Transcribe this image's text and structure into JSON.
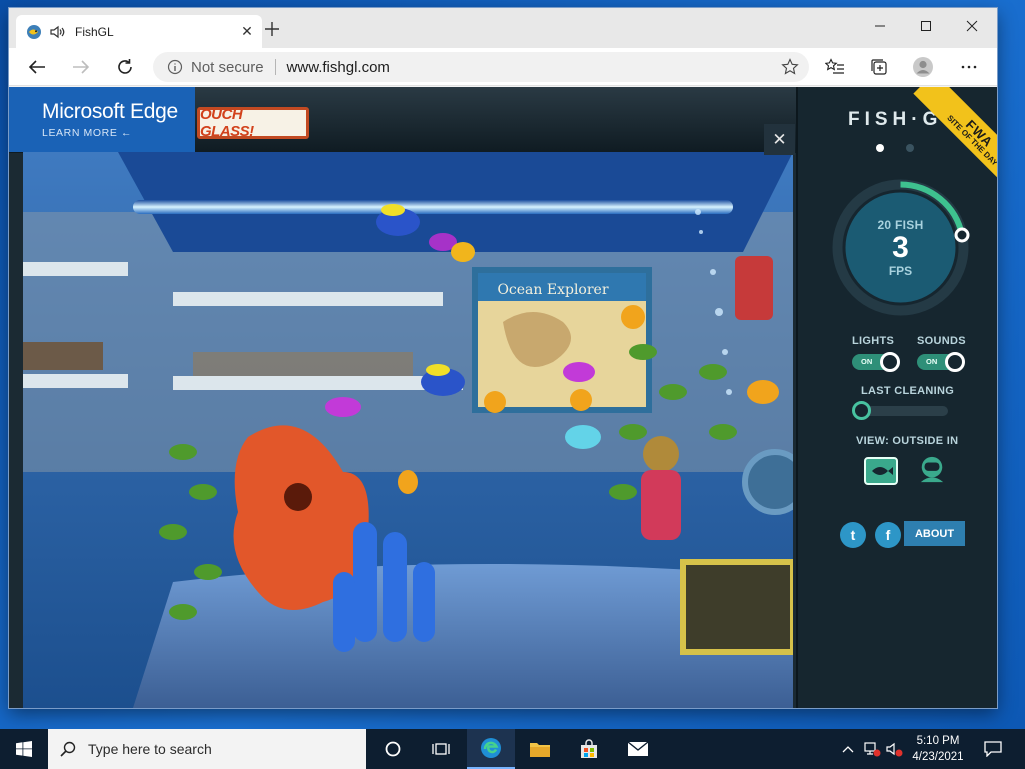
{
  "browser": {
    "tab": {
      "title": "FishGL",
      "favicon": "fish-favicon-icon",
      "audio": "speaker-icon"
    },
    "address": {
      "security": "Not secure",
      "url": "www.fishgl.com"
    }
  },
  "page": {
    "ad": {
      "title": "Microsoft Edge",
      "subtitle": "LEARN MORE ←"
    },
    "glass_sign": "OUCH GLASS!",
    "close_label": "✕",
    "poster": "Ocean Explorer",
    "panel": {
      "brand": "FISH·G",
      "ribbon": {
        "fwa": "FWA",
        "line": "SITE OF THE DAY"
      },
      "fish_count": "20 FISH",
      "fps": "3",
      "fps_label": "FPS",
      "lights_label": "LIGHTS",
      "lights_value": "ON",
      "sounds_label": "SOUNDS",
      "sounds_value": "ON",
      "cleaning_label": "LAST CLEANING",
      "cleaning_level": 0,
      "view_label": "VIEW: OUTSIDE IN",
      "about_label": "ABOUT",
      "accent": "#48c3a1"
    }
  },
  "taskbar": {
    "search_placeholder": "Type here to search",
    "time": "5:10 PM",
    "date": "4/23/2021"
  }
}
